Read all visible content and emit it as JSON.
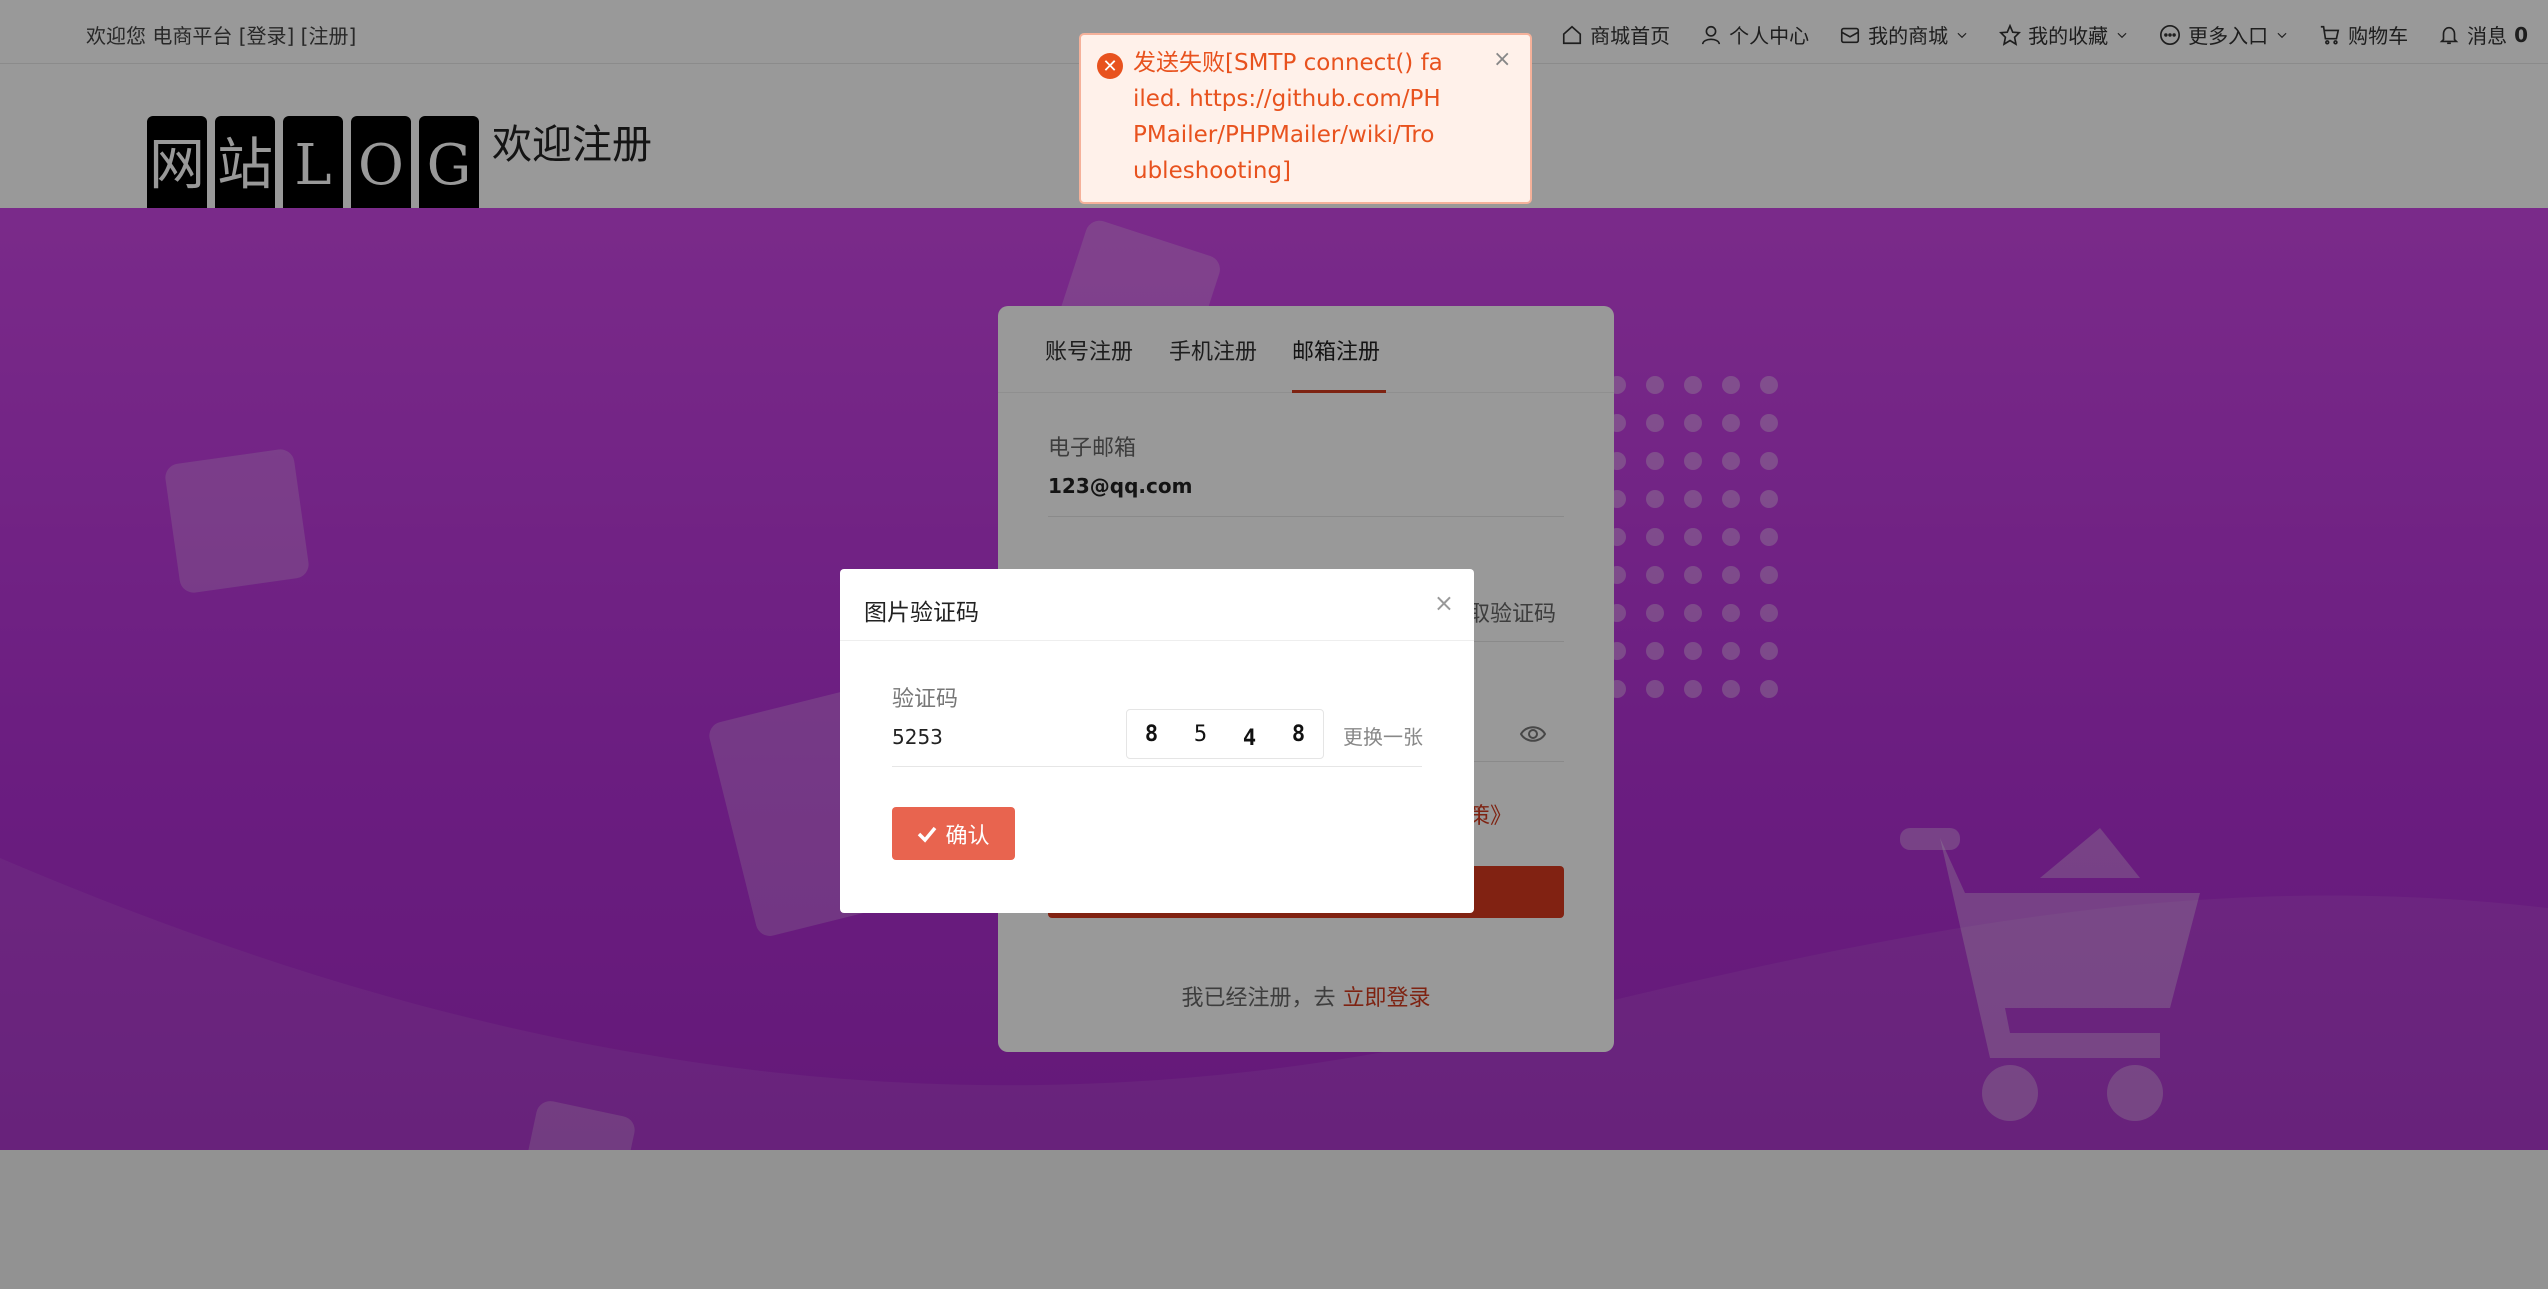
{
  "topbar": {
    "welcome": "欢迎您 电商平台 [登录] [注册]",
    "nav": [
      {
        "icon": "home-icon",
        "label": "商城首页"
      },
      {
        "icon": "user-icon",
        "label": "个人中心"
      },
      {
        "icon": "store-icon",
        "label": "我的商城"
      },
      {
        "icon": "star-icon",
        "label": "我的收藏"
      },
      {
        "icon": "more-icon",
        "label": "更多入口"
      },
      {
        "icon": "cart-icon",
        "label": "购物车"
      },
      {
        "icon": "bell-icon",
        "label": "消息",
        "count": "0"
      }
    ]
  },
  "header": {
    "logo_text": "网站LOG",
    "title": "欢迎注册"
  },
  "register": {
    "tabs": [
      "账号注册",
      "手机注册",
      "邮箱注册"
    ],
    "active_tab": "邮箱注册",
    "email_label": "电子邮箱",
    "email_value": "123@qq.com",
    "get_code_partial": "取验证码",
    "agreement_partial": "策》",
    "login_prefix": "我已经注册，去",
    "login_link": "立即登录"
  },
  "modal": {
    "title": "图片验证码",
    "close": "×",
    "captcha_label": "验证码",
    "captcha_input": "5253",
    "captcha_chars": [
      "8",
      "5",
      "4",
      "8"
    ],
    "refresh_label": "更换一张",
    "confirm_label": "确认"
  },
  "toast": {
    "icon": "error-icon",
    "message": "发送失败[SMTP connect() failed. https://github.com/PHPMailer/PHPMailer/wiki/Troubleshooting]",
    "close": "×"
  },
  "colors": {
    "banner": "#b231d6",
    "accent": "#d23b1f",
    "confirm": "#e8644f",
    "toast_text": "#e8521e"
  }
}
